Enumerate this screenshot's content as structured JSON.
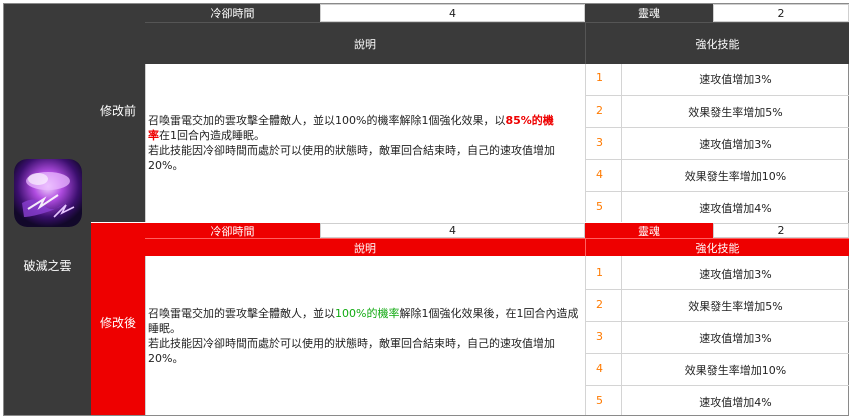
{
  "skill": {
    "name": "破滅之雲",
    "icon": "purple-storm-cloud-icon"
  },
  "labels": {
    "cooldown": "冷卻時間",
    "soul": "靈魂",
    "description": "說明",
    "enhance": "強化技能"
  },
  "before": {
    "label": "修改前",
    "cooldown": "4",
    "soul": "2",
    "desc_a": "召喚雷電交加的雲攻擊全體敵人，並以100%的機率解除1個強化效果，以",
    "desc_hl1": "85%的機",
    "desc_hl2": "率",
    "desc_b": "在1回合內造成睡眠。",
    "desc_c": "若此技能因冷卻時間而處於可以使用的狀態時，敵軍回合結束時，自己的速攻值增加20%。",
    "enhancements": [
      {
        "n": "1",
        "text": "速攻值增加3%"
      },
      {
        "n": "2",
        "text": "效果發生率增加5%"
      },
      {
        "n": "3",
        "text": "速攻值增加3%"
      },
      {
        "n": "4",
        "text": "效果發生率增加10%"
      },
      {
        "n": "5",
        "text": "速攻值增加4%"
      }
    ]
  },
  "after": {
    "label": "修改後",
    "cooldown": "4",
    "soul": "2",
    "desc_a": "召喚雷電交加的雲攻擊全體敵人，並以",
    "desc_hl": "100%的機率",
    "desc_b": "解除1個強化效果後，在1回合內造成睡眠。",
    "desc_c": "若此技能因冷卻時間而處於可以使用的狀態時，敵軍回合結束時，自己的速攻值增加20%。",
    "enhancements": [
      {
        "n": "1",
        "text": "速攻值增加3%"
      },
      {
        "n": "2",
        "text": "效果發生率增加5%"
      },
      {
        "n": "3",
        "text": "速攻值增加3%"
      },
      {
        "n": "4",
        "text": "效果發生率增加10%"
      },
      {
        "n": "5",
        "text": "速攻值增加4%"
      }
    ]
  },
  "colors": {
    "dark": "#3a3a3a",
    "red": "#ee0000",
    "number": "#ff7a00",
    "highlight_green": "#11aa11"
  }
}
